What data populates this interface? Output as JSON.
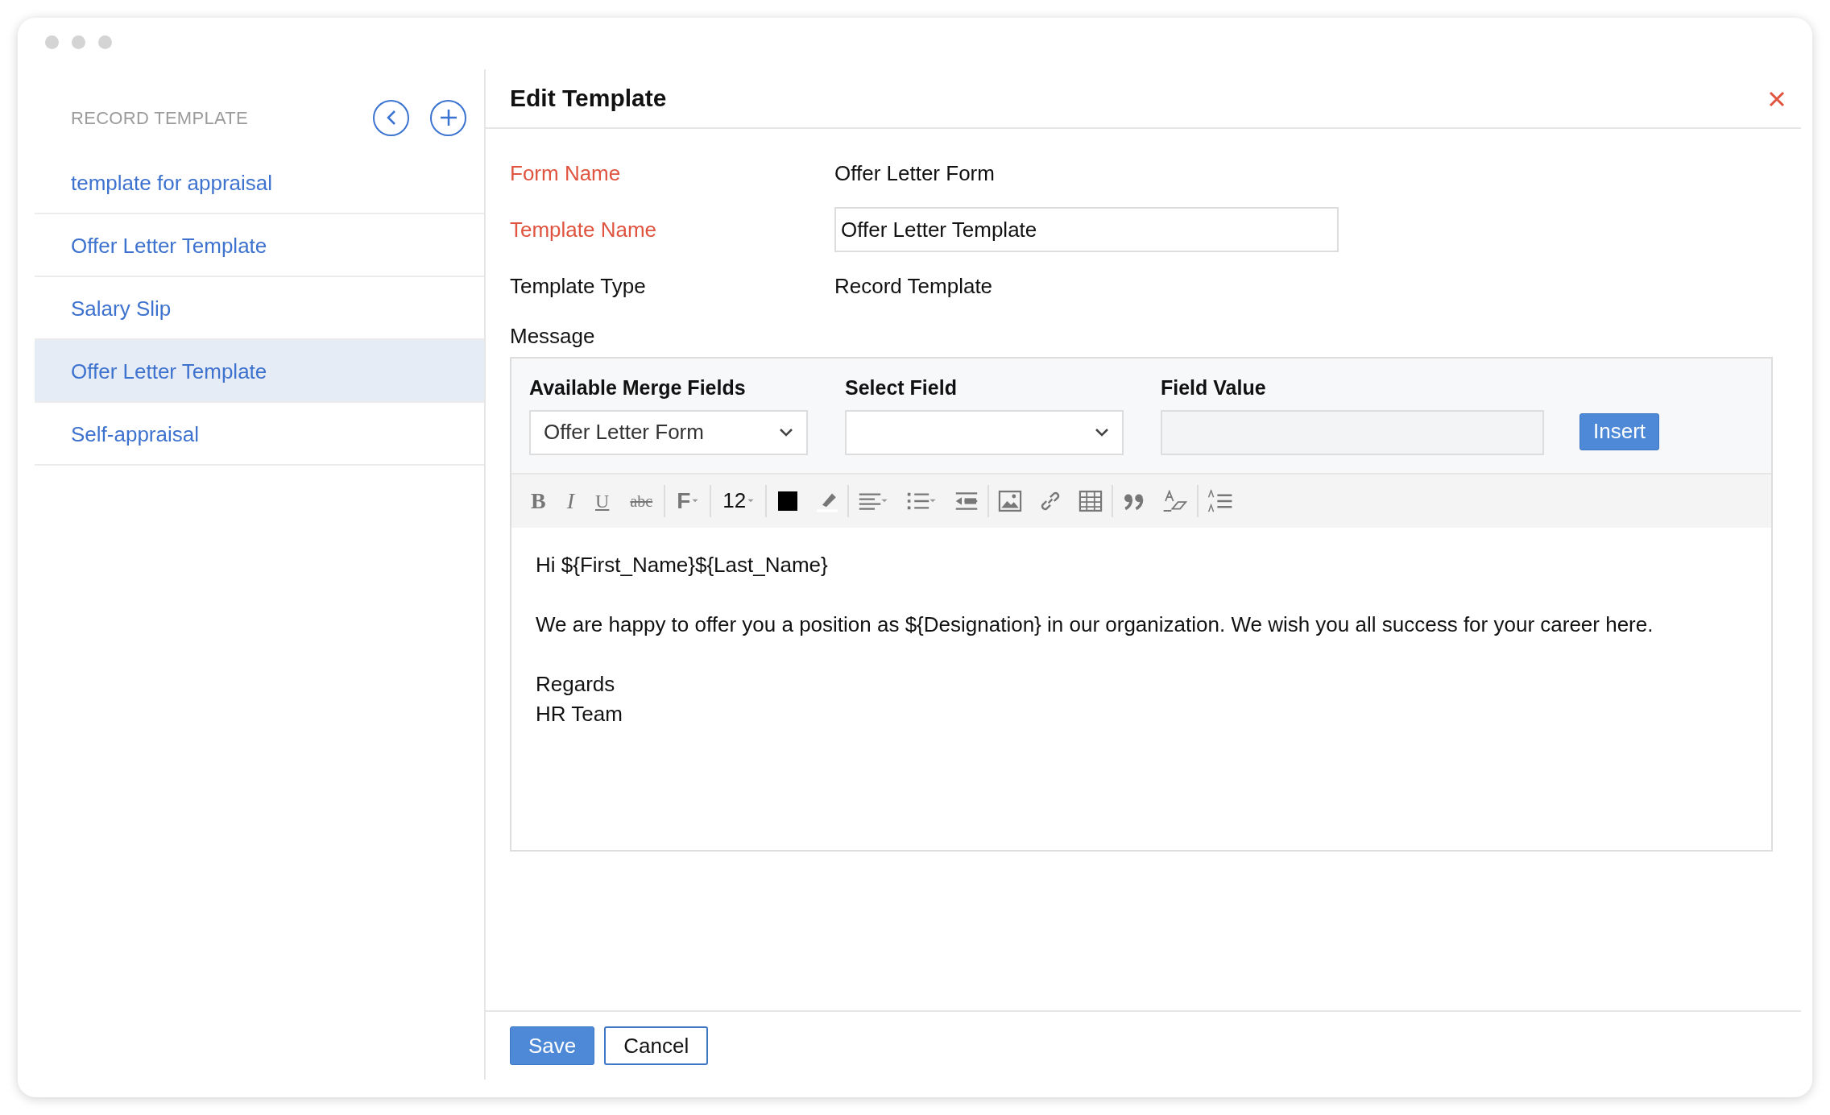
{
  "sidebar": {
    "title": "RECORD TEMPLATE",
    "items": [
      {
        "label": "template for appraisal",
        "selected": false
      },
      {
        "label": "Offer Letter Template",
        "selected": false
      },
      {
        "label": "Salary Slip",
        "selected": false
      },
      {
        "label": "Offer Letter Template",
        "selected": true
      },
      {
        "label": "Self-appraisal",
        "selected": false
      }
    ]
  },
  "panel": {
    "title": "Edit Template",
    "fields": [
      {
        "kind": "text",
        "label": "Form Name",
        "required": true,
        "value": "Offer Letter Form"
      },
      {
        "kind": "input",
        "label": "Template Name",
        "required": true,
        "value": "Offer Letter Template"
      },
      {
        "kind": "text",
        "label": "Template Type",
        "required": false,
        "value": "Record Template"
      }
    ],
    "message_label": "Message",
    "merge": {
      "columns": [
        {
          "kind": "select",
          "label": "Available Merge Fields",
          "value": "Offer Letter Form"
        },
        {
          "kind": "select",
          "label": "Select Field"
        },
        {
          "kind": "input",
          "label": "Field Value",
          "disabled": true
        }
      ],
      "button": "Insert"
    },
    "toolbar": [
      [
        {
          "kind": "bold",
          "label": "B"
        },
        {
          "kind": "italic",
          "label": "I"
        },
        {
          "kind": "underline",
          "label": "U"
        },
        {
          "kind": "strike",
          "label": "abc"
        }
      ],
      [
        {
          "kind": "font",
          "label": "F",
          "dropdown": true
        }
      ],
      [
        {
          "kind": "size",
          "label": "12",
          "dropdown": true
        }
      ],
      [
        {
          "kind": "swatch",
          "color": "#000000"
        },
        {
          "kind": "highlighter"
        }
      ],
      [
        {
          "kind": "align",
          "dropdown": true
        },
        {
          "kind": "list",
          "dropdown": true
        },
        {
          "kind": "outdent"
        }
      ],
      [
        {
          "kind": "image"
        },
        {
          "kind": "link"
        },
        {
          "kind": "table"
        }
      ],
      [
        {
          "kind": "quote"
        },
        {
          "kind": "clear"
        }
      ],
      [
        {
          "kind": "spacing"
        }
      ]
    ],
    "body": [
      [
        "Hi ${First_Name}${Last_Name}"
      ],
      [
        "We are happy to offer you a position as ${Designation} in our organization. We wish you all success for your career here."
      ],
      [
        "Regards",
        "HR Team"
      ]
    ],
    "actions": [
      {
        "kind": "primary",
        "label": "Save"
      },
      {
        "kind": "secondary",
        "label": "Cancel"
      }
    ]
  }
}
